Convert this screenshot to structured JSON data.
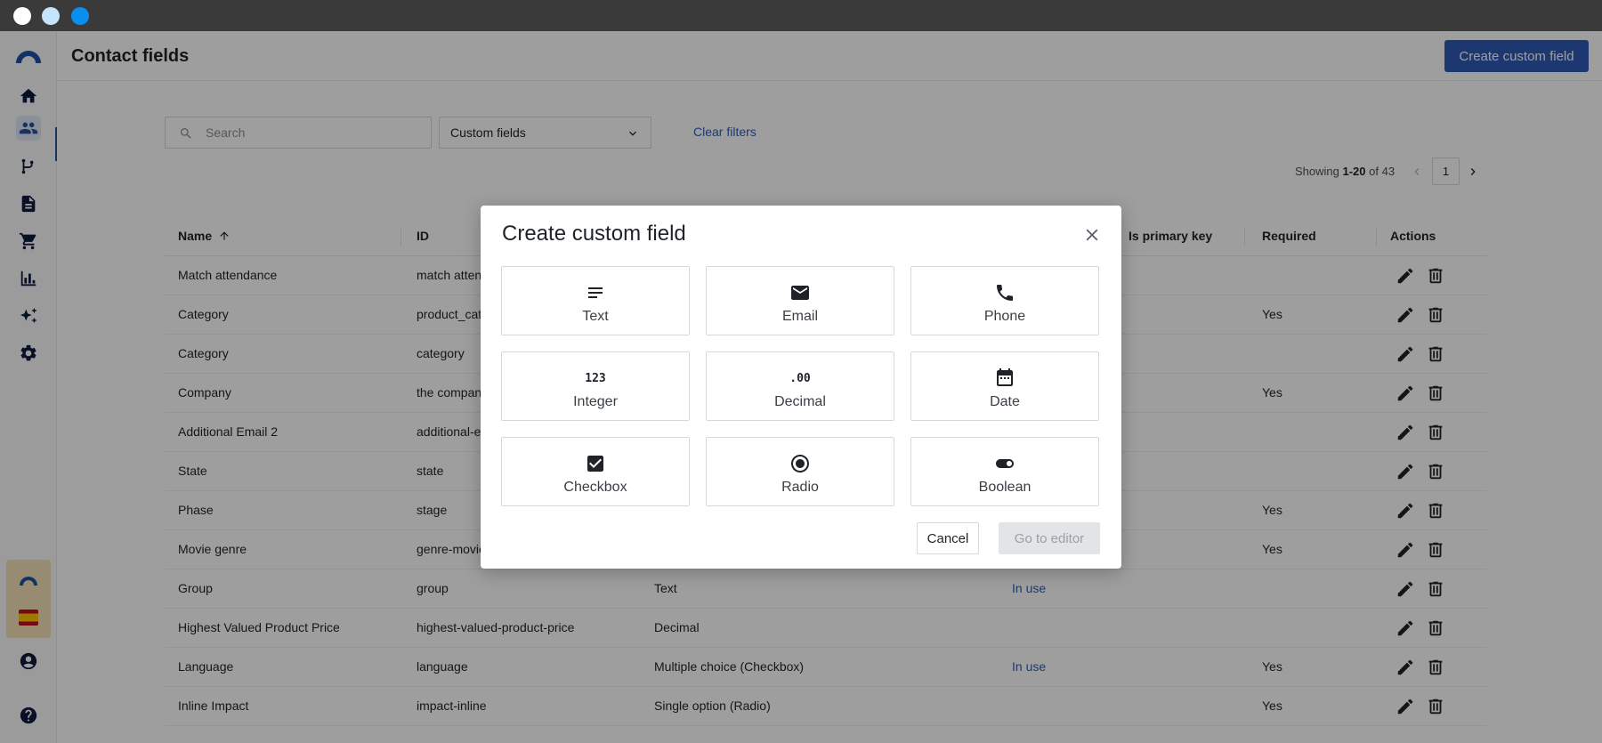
{
  "window": {
    "traffic_lights": [
      "close",
      "minimize",
      "maximize"
    ]
  },
  "sidebar": {
    "items": [
      {
        "name": "home-icon"
      },
      {
        "name": "contacts-icon",
        "active": true
      },
      {
        "name": "flows-icon"
      },
      {
        "name": "templates-icon"
      },
      {
        "name": "cart-icon"
      },
      {
        "name": "analytics-icon"
      },
      {
        "name": "ai-sparkle-icon"
      },
      {
        "name": "settings-icon"
      }
    ],
    "bottom": [
      {
        "name": "user-icon"
      },
      {
        "name": "help-icon"
      }
    ]
  },
  "header": {
    "title": "Contact fields",
    "create_button": "Create custom field"
  },
  "filters": {
    "search_placeholder": "Search",
    "select_value": "Custom fields",
    "clear_label": "Clear filters"
  },
  "pagination": {
    "prefix": "Showing",
    "range": "1-20",
    "of_text": "of 43",
    "current_page": "1"
  },
  "table": {
    "columns": {
      "name": "Name",
      "id": "ID",
      "primary_key": "Is primary key",
      "required": "Required",
      "actions": "Actions"
    },
    "rows": [
      {
        "name": "Match attendance",
        "id": "match attend",
        "type": "",
        "usage": "",
        "required": ""
      },
      {
        "name": "Category",
        "id": "product_cat",
        "type": "",
        "usage": "",
        "required": "Yes"
      },
      {
        "name": "Category",
        "id": "category",
        "type": "",
        "usage": "",
        "required": ""
      },
      {
        "name": "Company",
        "id": "the company",
        "type": "",
        "usage": "",
        "required": "Yes"
      },
      {
        "name": "Additional Email 2",
        "id": "additional-e",
        "type": "",
        "usage": "",
        "required": ""
      },
      {
        "name": "State",
        "id": "state",
        "type": "",
        "usage": "",
        "required": ""
      },
      {
        "name": "Phase",
        "id": "stage",
        "type": "",
        "usage": "",
        "required": "Yes"
      },
      {
        "name": "Movie genre",
        "id": "genre-movie",
        "type": "",
        "usage": "",
        "required": "Yes"
      },
      {
        "name": "Group",
        "id": "group",
        "type": "Text",
        "usage": "In use",
        "required": ""
      },
      {
        "name": "Highest Valued Product Price",
        "id": "highest-valued-product-price",
        "type": "Decimal",
        "usage": "",
        "required": ""
      },
      {
        "name": "Language",
        "id": "language",
        "type": "Multiple choice (Checkbox)",
        "usage": "In use",
        "required": "Yes"
      },
      {
        "name": "Inline Impact",
        "id": "impact-inline",
        "type": "Single option (Radio)",
        "usage": "",
        "required": "Yes"
      }
    ]
  },
  "modal": {
    "title": "Create custom field",
    "types": [
      {
        "label": "Text",
        "icon": "text-icon"
      },
      {
        "label": "Email",
        "icon": "email-icon"
      },
      {
        "label": "Phone",
        "icon": "phone-icon"
      },
      {
        "label": "Integer",
        "icon": "integer-icon",
        "glyph": "123"
      },
      {
        "label": "Decimal",
        "icon": "decimal-icon",
        "glyph": ".00"
      },
      {
        "label": "Date",
        "icon": "calendar-icon"
      },
      {
        "label": "Checkbox",
        "icon": "checkbox-icon"
      },
      {
        "label": "Radio",
        "icon": "radio-icon"
      },
      {
        "label": "Boolean",
        "icon": "toggle-icon"
      }
    ],
    "cancel_label": "Cancel",
    "editor_label": "Go to editor"
  },
  "colors": {
    "primary": "#2f5bb7",
    "overlay": "rgba(0,0,0,0.38)"
  }
}
